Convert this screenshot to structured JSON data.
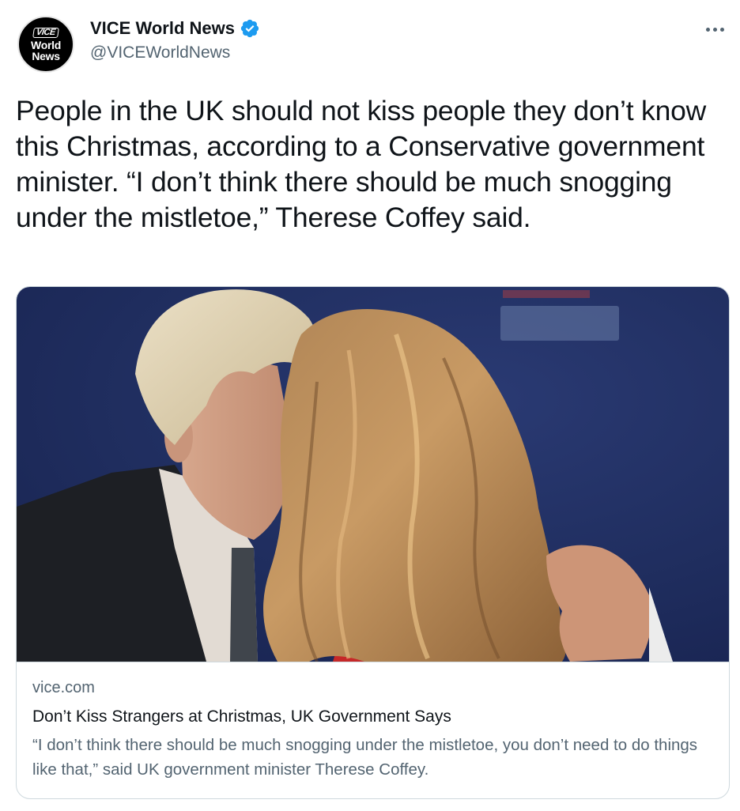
{
  "author": {
    "avatar_lines": [
      "VICE",
      "World",
      "News"
    ],
    "name": "VICE World News",
    "handle": "@VICEWorldNews",
    "verified": true
  },
  "tweet": {
    "text": "People in the UK should not kiss people they don’t know this Christmas, according to a Conservative government minister. “I don’t think there should be much snogging under the mistletoe,” Therese Coffey said."
  },
  "card": {
    "domain": "vice.com",
    "title": "Don’t Kiss Strangers at Christmas, UK Government Says",
    "description": "“I don’t think there should be much snogging under the mistletoe, you don’t need to do things like that,” said UK government minister Therese Coffey."
  },
  "icons": {
    "verified": "verified-badge-icon",
    "more": "more-options-icon"
  },
  "colors": {
    "verified_blue": "#1d9bf0",
    "secondary_text": "#536471",
    "primary_text": "#0f1419",
    "border": "#cfd9de"
  }
}
